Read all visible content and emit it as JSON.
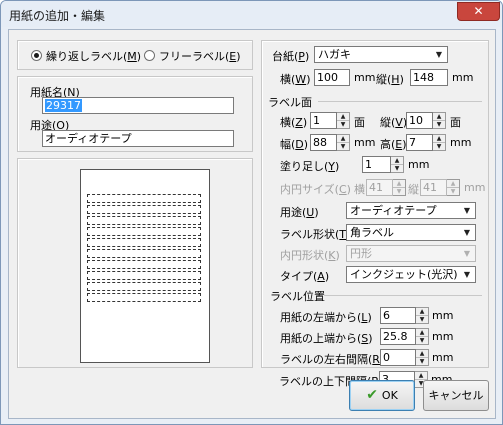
{
  "window": {
    "title": "用紙の追加・編集",
    "close_glyph": "✕"
  },
  "label_type": {
    "options": [
      {
        "label": "繰り返しラベル(",
        "key": "M",
        "suffix": ")",
        "selected": true
      },
      {
        "label": "フリーラベル(",
        "key": "E",
        "suffix": ")",
        "selected": false
      }
    ]
  },
  "paper_name": {
    "label_pre": "用紙名(",
    "key": "N",
    "label_post": ")",
    "value": "29317"
  },
  "purpose_top": {
    "label_pre": "用途(",
    "key": "O",
    "label_post": ")",
    "value": "オーディオテープ"
  },
  "mount": {
    "label_pre": "台紙(",
    "key": "P",
    "label_post": ")",
    "value": "ハガキ",
    "width": {
      "label_pre": "横(",
      "key": "W",
      "label_post": ")",
      "value": "100",
      "unit": "mm"
    },
    "height": {
      "label_pre": "縦(",
      "key": "H",
      "label_post": ")",
      "value": "148",
      "unit": "mm"
    }
  },
  "label_face": {
    "heading": "ラベル面",
    "cols": {
      "label_pre": "横(",
      "key": "Z",
      "label_post": ")",
      "value": "1",
      "unit": "面"
    },
    "rows": {
      "label_pre": "縦(",
      "key": "V",
      "label_post": ")",
      "value": "10",
      "unit": "面"
    },
    "w": {
      "label_pre": "幅(",
      "key": "D",
      "label_post": ")",
      "value": "88",
      "unit": "mm"
    },
    "h": {
      "label_pre": "高(",
      "key": "E",
      "label_post": ")",
      "value": "7",
      "unit": "mm"
    },
    "bleed": {
      "label_pre": "塗り足し(",
      "key": "Y",
      "label_post": ")",
      "value": "1",
      "unit": "mm"
    },
    "circle": {
      "label_pre": "内円サイズ(",
      "key": "C",
      "label_post": ")",
      "w_label": "横",
      "w_value": "41",
      "h_label": "縦",
      "h_value": "41",
      "unit": "mm"
    }
  },
  "purpose": {
    "label_pre": "用途(",
    "key": "U",
    "label_post": ")",
    "value": "オーディオテープ"
  },
  "shape": {
    "label_pre": "ラベル形状(",
    "key": "T",
    "label_post": ")",
    "value": "角ラベル"
  },
  "circle_shape": {
    "label_pre": "内円形状(",
    "key": "K",
    "label_post": ")",
    "value": "円形"
  },
  "printer_type": {
    "label_pre": "タイプ(",
    "key": "A",
    "label_post": ")",
    "value": "インクジェット(光沢)"
  },
  "position": {
    "heading": "ラベル位置",
    "left": {
      "label_pre": "用紙の左端から(",
      "key": "L",
      "label_post": ")",
      "value": "6",
      "unit": "mm"
    },
    "top": {
      "label_pre": "用紙の上端から(",
      "key": "S",
      "label_post": ")",
      "value": "25.8",
      "unit": "mm"
    },
    "hgap": {
      "label_pre": "ラベルの左右間隔(",
      "key": "R",
      "label_post": ")",
      "value": "0",
      "unit": "mm"
    },
    "vgap": {
      "label_pre": "ラベルの上下間隔(",
      "key": "B",
      "label_post": ")",
      "value": "3",
      "unit": "mm"
    }
  },
  "preview": {
    "label_count": 10
  },
  "buttons": {
    "ok": "OK",
    "ok_glyph": "✔",
    "cancel": "キャンセル"
  },
  "colors": {
    "accent": "#3399ff",
    "close": "#c9463d",
    "ok_check": "#3a9a2a"
  }
}
